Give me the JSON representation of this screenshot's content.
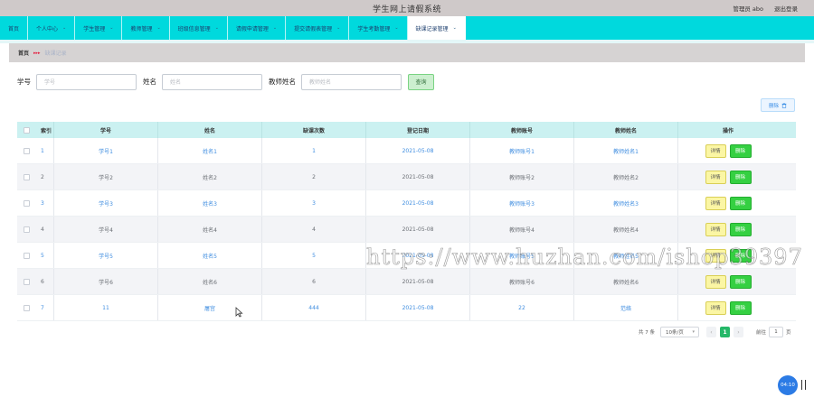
{
  "app": {
    "title": "学生网上请假系统",
    "admin": "管理员 abo",
    "logout": "退出登录"
  },
  "nav": [
    {
      "label": "首页",
      "chevron": false
    },
    {
      "label": "个人中心",
      "chevron": true
    },
    {
      "label": "学生管理",
      "chevron": true
    },
    {
      "label": "教师管理",
      "chevron": true
    },
    {
      "label": "班级信息管理",
      "chevron": true
    },
    {
      "label": "请假申请管理",
      "chevron": true
    },
    {
      "label": "提交请假表管理",
      "chevron": true
    },
    {
      "label": "学生考勤管理",
      "chevron": true
    },
    {
      "label": "缺课记录管理",
      "chevron": true
    }
  ],
  "breadcrumb": {
    "home": "首页",
    "sep": "▸▸▸",
    "current": "缺课记录"
  },
  "search": {
    "student_label": "学号",
    "student_placeholder": "学号",
    "name_label": "姓名",
    "name_placeholder": "姓名",
    "teacher_label": "教师姓名",
    "teacher_placeholder": "教师姓名",
    "query_button": "查询"
  },
  "delete_button": "删除",
  "table": {
    "headers": [
      "索引",
      "学号",
      "姓名",
      "缺课次数",
      "登记日期",
      "教师账号",
      "教师姓名",
      "操作"
    ],
    "detail_label": "详情",
    "delete_label": "删除",
    "rows": [
      {
        "index": "1",
        "student_no": "学号1",
        "name": "姓名1",
        "count": "1",
        "date": "2021-05-08",
        "teacher_no": "教师账号1",
        "teacher_name": "教师姓名1",
        "highlight": true
      },
      {
        "index": "2",
        "student_no": "学号2",
        "name": "姓名2",
        "count": "2",
        "date": "2021-05-08",
        "teacher_no": "教师账号2",
        "teacher_name": "教师姓名2",
        "highlight": false
      },
      {
        "index": "3",
        "student_no": "学号3",
        "name": "姓名3",
        "count": "3",
        "date": "2021-05-08",
        "teacher_no": "教师账号3",
        "teacher_name": "教师姓名3",
        "highlight": true
      },
      {
        "index": "4",
        "student_no": "学号4",
        "name": "姓名4",
        "count": "4",
        "date": "2021-05-08",
        "teacher_no": "教师账号4",
        "teacher_name": "教师姓名4",
        "highlight": false
      },
      {
        "index": "5",
        "student_no": "学号5",
        "name": "姓名5",
        "count": "5",
        "date": "2021-05-08",
        "teacher_no": "教师账号5",
        "teacher_name": "教师姓名5",
        "highlight": true
      },
      {
        "index": "6",
        "student_no": "学号6",
        "name": "姓名6",
        "count": "6",
        "date": "2021-05-08",
        "teacher_no": "教师账号6",
        "teacher_name": "教师姓名6",
        "highlight": false
      },
      {
        "index": "7",
        "student_no": "11",
        "name": "屠宫",
        "count": "444",
        "date": "2021-05-08",
        "teacher_no": "22",
        "teacher_name": "范络",
        "highlight": true
      }
    ]
  },
  "pager": {
    "total": "共 7 条",
    "page_size": "10条/页",
    "prev": "‹",
    "current_page": "1",
    "next": "›",
    "goto_label": "前往",
    "goto_value": "1",
    "goto_unit": "页"
  },
  "watermark": "https://www.huzhan.com/ishop39397",
  "timer": "04:10",
  "colors": {
    "nav_bg": "#00d9dd",
    "header_bg": "#cbf1f1",
    "detail_btn": "#fbf6a4",
    "delete_btn": "#35d042",
    "link_blue": "#3f8de0"
  }
}
